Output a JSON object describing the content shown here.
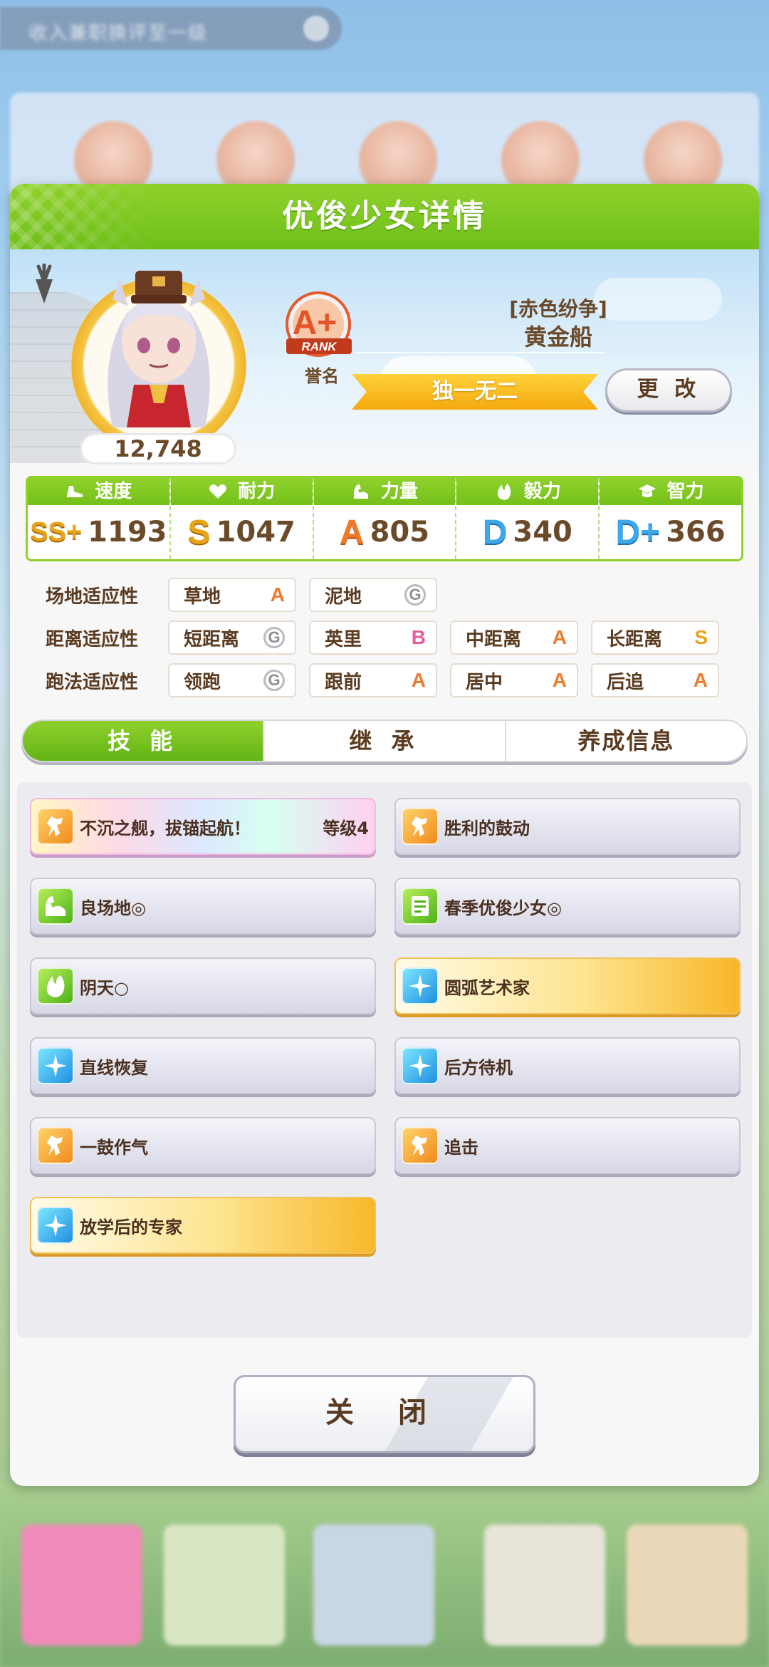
{
  "background": {
    "top_bar_text": "收入兼职换评至一级"
  },
  "panel": {
    "title": "优俊少女详情"
  },
  "character": {
    "score": "12,748",
    "rank_grade": "A+",
    "rank_word": "RANK",
    "rank_label": "誉名",
    "epithet": "[赤色纷争]",
    "name": "黄金船",
    "title": "独一无二",
    "change_button": "更 改"
  },
  "stats": [
    {
      "label": "速度",
      "icon": "shoe-icon",
      "grade": "SS+",
      "value": "1193"
    },
    {
      "label": "耐力",
      "icon": "heart-icon",
      "grade": "S",
      "value": "1047"
    },
    {
      "label": "力量",
      "icon": "muscle-icon",
      "grade": "A",
      "value": "805"
    },
    {
      "label": "毅力",
      "icon": "flame-icon",
      "grade": "D",
      "value": "340"
    },
    {
      "label": "智力",
      "icon": "graduation-cap-icon",
      "grade": "D+",
      "value": "366"
    }
  ],
  "aptitude": {
    "track": {
      "label": "场地适应性",
      "items": [
        {
          "name": "草地",
          "grade": "A"
        },
        {
          "name": "泥地",
          "grade": "G"
        }
      ]
    },
    "distance": {
      "label": "距离适应性",
      "items": [
        {
          "name": "短距离",
          "grade": "G"
        },
        {
          "name": "英里",
          "grade": "B"
        },
        {
          "name": "中距离",
          "grade": "A"
        },
        {
          "name": "长距离",
          "grade": "S"
        }
      ]
    },
    "style": {
      "label": "跑法适应性",
      "items": [
        {
          "name": "领跑",
          "grade": "G"
        },
        {
          "name": "跟前",
          "grade": "A"
        },
        {
          "name": "居中",
          "grade": "A"
        },
        {
          "name": "后追",
          "grade": "A"
        }
      ]
    }
  },
  "tabs": [
    {
      "label": "技 能",
      "active": true
    },
    {
      "label": "继 承",
      "active": false
    },
    {
      "label": "养成信息",
      "active": false
    }
  ],
  "skills": [
    {
      "name": "不沉之舰，拔锚起航！",
      "level": "等级4",
      "icon": "orange",
      "style": "rainbow"
    },
    {
      "name": "胜利的鼓动",
      "level": "",
      "icon": "orange",
      "style": "normal"
    },
    {
      "name": "良场地◎",
      "level": "",
      "icon": "green",
      "style": "normal"
    },
    {
      "name": "春季优俊少女◎",
      "level": "",
      "icon": "green",
      "style": "normal"
    },
    {
      "name": "阴天○",
      "level": "",
      "icon": "green",
      "style": "normal"
    },
    {
      "name": "圆弧艺术家",
      "level": "",
      "icon": "blue",
      "style": "gold"
    },
    {
      "name": "直线恢复",
      "level": "",
      "icon": "blue",
      "style": "normal"
    },
    {
      "name": "后方待机",
      "level": "",
      "icon": "blue",
      "style": "normal"
    },
    {
      "name": "一鼓作气",
      "level": "",
      "icon": "orange",
      "style": "normal"
    },
    {
      "name": "追击",
      "level": "",
      "icon": "orange",
      "style": "normal"
    },
    {
      "name": "放学后的专家",
      "level": "",
      "icon": "blue",
      "style": "gold"
    }
  ],
  "close_button": "关 闭",
  "colors": {
    "accent_green": "#7cc61f",
    "text_brown": "#5a3b20",
    "gold": "#f5a90e"
  }
}
